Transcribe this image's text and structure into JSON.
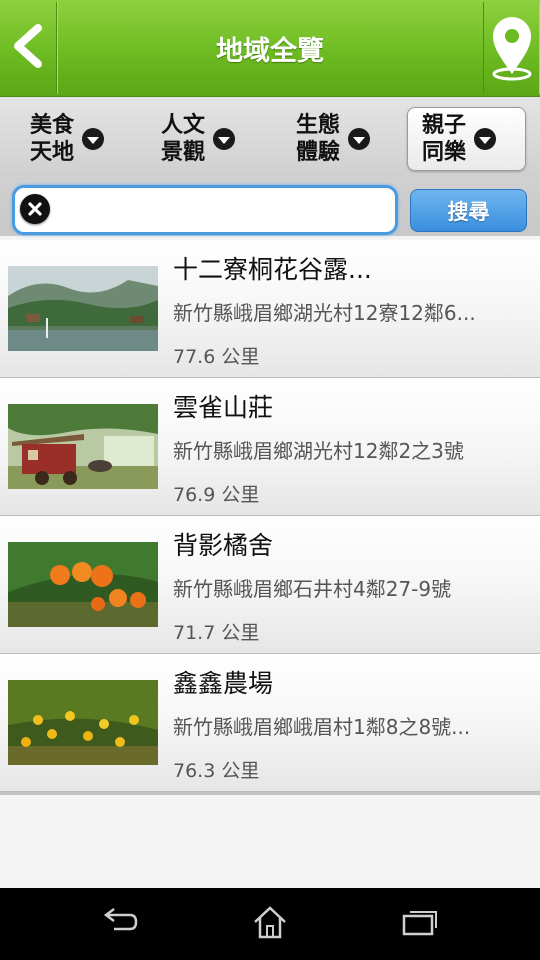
{
  "header": {
    "title": "地域全覽",
    "back_icon": "chevron-left-icon",
    "map_icon": "map-pin-icon"
  },
  "categories": [
    {
      "label_line1": "美食",
      "label_line2": "天地",
      "active": false
    },
    {
      "label_line1": "人文",
      "label_line2": "景觀",
      "active": false
    },
    {
      "label_line1": "生態",
      "label_line2": "體驗",
      "active": false
    },
    {
      "label_line1": "親子",
      "label_line2": "同樂",
      "active": true
    }
  ],
  "search": {
    "value": "",
    "placeholder": "",
    "button_label": "搜尋"
  },
  "items": [
    {
      "title": "十二寮桐花谷露...",
      "address": "新竹縣峨眉鄉湖光村12寮12鄰6...",
      "distance": "77.6 公里"
    },
    {
      "title": "雲雀山莊",
      "address": "新竹縣峨眉鄉湖光村12鄰2之3號",
      "distance": "76.9 公里"
    },
    {
      "title": "背影橘舍",
      "address": "新竹縣峨眉鄉石井村4鄰27-9號",
      "distance": "71.7 公里"
    },
    {
      "title": "鑫鑫農場",
      "address": "新竹縣峨眉鄉峨眉村1鄰8之8號...",
      "distance": "76.3 公里"
    }
  ],
  "colors": {
    "header_green": "#6dbb22",
    "search_blue": "#3a8fde"
  },
  "nav": {
    "back_icon": "nav-back-icon",
    "home_icon": "nav-home-icon",
    "recents_icon": "nav-recents-icon"
  }
}
